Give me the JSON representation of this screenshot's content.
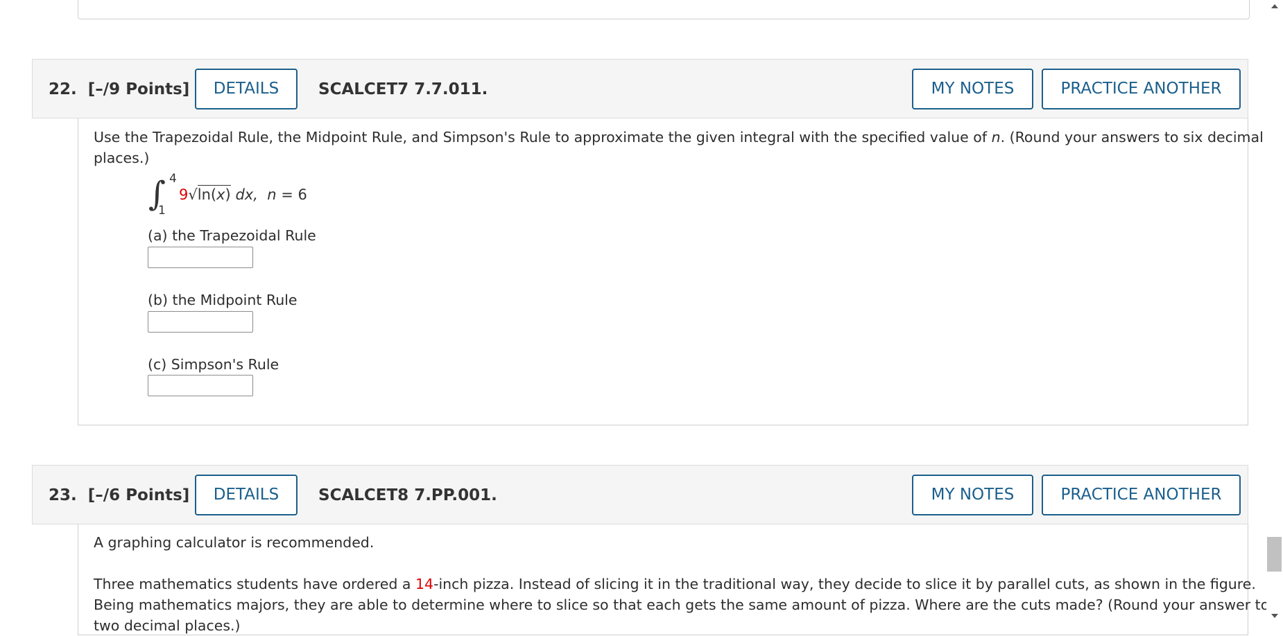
{
  "questions": [
    {
      "number": "22.",
      "points": "[–/9 Points]",
      "details_label": "DETAILS",
      "code": "SCALCET7 7.7.011.",
      "my_notes_label": "MY NOTES",
      "practice_label": "PRACTICE ANOTHER",
      "prompt_line1": "Use the Trapezoidal Rule, the Midpoint Rule, and Simpson's Rule to approximate the given integral with the specified value of",
      "prompt_var": "n",
      "prompt_line1_end": ". (Round your answers to six decimal",
      "prompt_line2": "places.)",
      "integral": {
        "upper": "4",
        "lower": "1",
        "coef": "9",
        "sqrt_prefix": "√",
        "arg_a": "ln(",
        "arg_x": "x",
        "arg_b": ")",
        "dx": "dx,",
        "n_var": "n",
        "n_value": "= 6"
      },
      "parts": [
        {
          "label": "(a) the Trapezoidal Rule",
          "value": ""
        },
        {
          "label": "(b) the Midpoint Rule",
          "value": ""
        },
        {
          "label": "(c) Simpson's Rule",
          "value": ""
        }
      ]
    },
    {
      "number": "23.",
      "points": "[–/6 Points]",
      "details_label": "DETAILS",
      "code": "SCALCET8 7.PP.001.",
      "my_notes_label": "MY NOTES",
      "practice_label": "PRACTICE ANOTHER",
      "note": "A graphing calculator is recommended.",
      "para_start": "Three mathematics students have ordered a",
      "para_red": "14",
      "para_rest": "-inch pizza. Instead of slicing it in the traditional way, they decide to slice it by parallel cuts, as shown in the figure.",
      "para_line2": "Being mathematics majors, they are able to determine where to slice so that each gets the same amount of pizza. Where are the cuts made? (Round your answer to",
      "para_line3": "two decimal places.)"
    }
  ],
  "colors": {
    "accent": "#1b5f8c",
    "highlight": "#e00000",
    "header_bg": "#f5f5f5"
  },
  "scrollbar": {
    "up_icon": "triangle-up",
    "down_icon": "triangle-down"
  }
}
